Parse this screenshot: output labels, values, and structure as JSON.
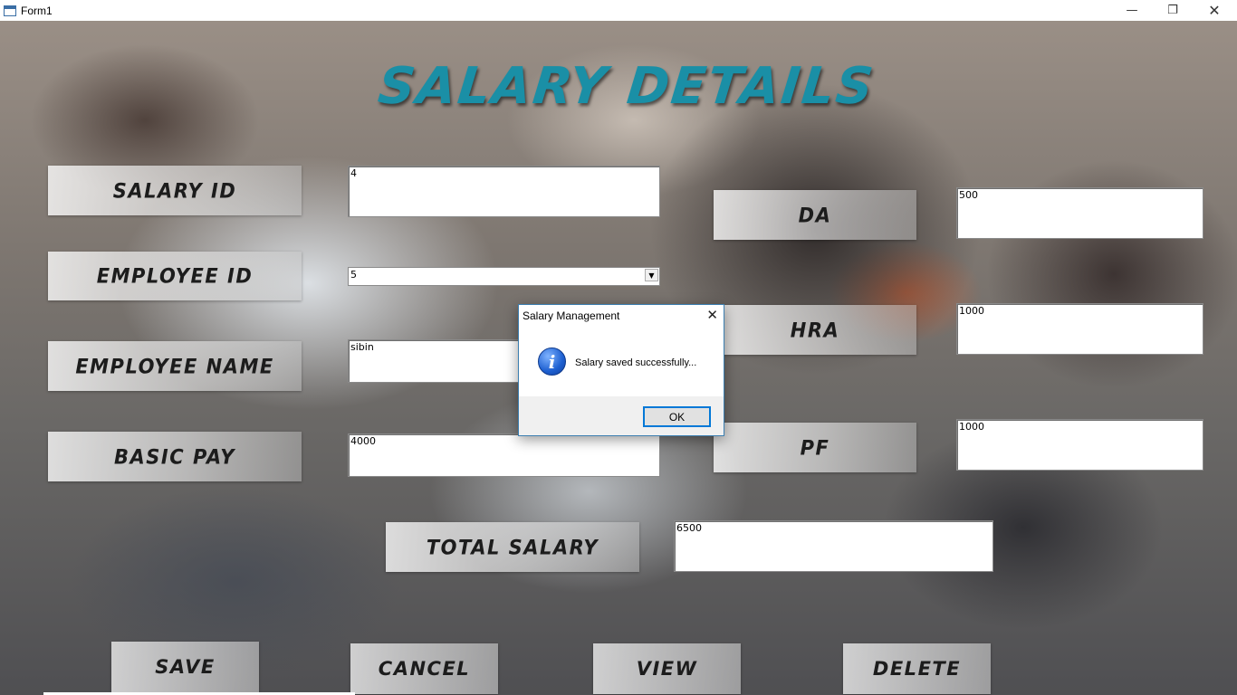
{
  "window": {
    "title": "Form1",
    "minimize_glyph": "—",
    "maximize_glyph": "❐",
    "close_glyph": "✕"
  },
  "form": {
    "heading": "SALARY DETAILS",
    "labels": {
      "salary_id": "SALARY ID",
      "employee_id": "EMPLOYEE ID",
      "employee_name": "EMPLOYEE NAME",
      "basic_pay": "BASIC PAY",
      "da": "DA",
      "hra": "HRA",
      "pf": "PF",
      "total_salary": "TOTAL SALARY"
    },
    "values": {
      "salary_id": "4",
      "employee_id": "5",
      "employee_name": "sibin",
      "basic_pay": "4000",
      "da": "500",
      "hra": "1000",
      "pf": "1000",
      "total_salary": "6500"
    },
    "buttons": {
      "save": "SAVE",
      "cancel": "CANCEL",
      "view": "VIEW",
      "delete": "DELETE"
    }
  },
  "dialog": {
    "title": "Salary Management",
    "message": "Salary saved successfully...",
    "ok_label": "OK",
    "icon": "info-icon",
    "close_glyph": "✕"
  },
  "colors": {
    "heading": "#1a8fa6",
    "dialog_border": "#3c7fb1",
    "ok_focus": "#0078d7"
  }
}
